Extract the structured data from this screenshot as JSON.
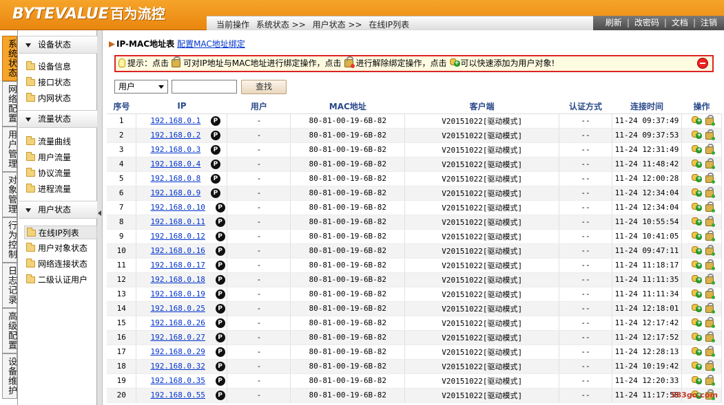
{
  "header": {
    "logo_text": "BYTEVALUE",
    "logo_cn": "百为流控",
    "breadcrumb": [
      "当前操作",
      "系统状态 >>",
      "用户状态 >>",
      "在线IP列表"
    ],
    "links": [
      "刷新",
      "改密码",
      "文档",
      "注销"
    ]
  },
  "vtabs": [
    "系统状态",
    "网络配置",
    "用户管理",
    "对象管理",
    "行为控制",
    "日志记录",
    "高级配置",
    "设备维护"
  ],
  "sidebar": {
    "sections": [
      {
        "title": "设备状态",
        "items": [
          "设备信息",
          "接口状态",
          "内网状态"
        ]
      },
      {
        "title": "流量状态",
        "items": [
          "流量曲线",
          "用户流量",
          "协议流量",
          "进程流量"
        ]
      },
      {
        "title": "用户状态",
        "items": [
          "在线IP列表",
          "用户对象状态",
          "网络连接状态",
          "二级认证用户"
        ]
      }
    ],
    "active_item": "在线IP列表"
  },
  "main": {
    "title": "IP-MAC地址表",
    "sub_link": "配置MAC地址绑定",
    "tip": {
      "prefix": "提示：点击",
      "part1": "可对IP地址与MAC地址进行绑定操作，点击",
      "part2": "进行解除绑定操作，点击",
      "part3": "可以快速添加为用户对象!"
    },
    "filter": {
      "select_value": "用户",
      "input_value": "",
      "search_label": "查找"
    },
    "columns": [
      "序号",
      "IP",
      "用户",
      "MAC地址",
      "客户端",
      "认证方式",
      "连接时间",
      "操作"
    ],
    "p_badge": "P",
    "rows": [
      {
        "no": "1",
        "ip": "192.168.0.1",
        "user": "-",
        "mac": "80-81-00-19-6B-82",
        "client": "V20151022[驱动模式]",
        "auth": "--",
        "time": "11-24 09:37:49"
      },
      {
        "no": "2",
        "ip": "192.168.0.2",
        "user": "-",
        "mac": "80-81-00-19-6B-82",
        "client": "V20151022[驱动模式]",
        "auth": "--",
        "time": "11-24 09:37:53"
      },
      {
        "no": "3",
        "ip": "192.168.0.3",
        "user": "-",
        "mac": "80-81-00-19-6B-82",
        "client": "V20151022[驱动模式]",
        "auth": "--",
        "time": "11-24 12:31:49"
      },
      {
        "no": "4",
        "ip": "192.168.0.4",
        "user": "-",
        "mac": "80-81-00-19-6B-82",
        "client": "V20151022[驱动模式]",
        "auth": "--",
        "time": "11-24 11:48:42"
      },
      {
        "no": "5",
        "ip": "192.168.0.8",
        "user": "-",
        "mac": "80-81-00-19-6B-82",
        "client": "V20151022[驱动模式]",
        "auth": "--",
        "time": "11-24 12:00:28"
      },
      {
        "no": "6",
        "ip": "192.168.0.9",
        "user": "-",
        "mac": "80-81-00-19-6B-82",
        "client": "V20151022[驱动模式]",
        "auth": "--",
        "time": "11-24 12:34:04"
      },
      {
        "no": "7",
        "ip": "192.168.0.10",
        "user": "-",
        "mac": "80-81-00-19-6B-82",
        "client": "V20151022[驱动模式]",
        "auth": "--",
        "time": "11-24 12:34:04"
      },
      {
        "no": "8",
        "ip": "192.168.0.11",
        "user": "-",
        "mac": "80-81-00-19-6B-82",
        "client": "V20151022[驱动模式]",
        "auth": "--",
        "time": "11-24 10:55:54"
      },
      {
        "no": "9",
        "ip": "192.168.0.12",
        "user": "-",
        "mac": "80-81-00-19-6B-82",
        "client": "V20151022[驱动模式]",
        "auth": "--",
        "time": "11-24 10:41:05"
      },
      {
        "no": "10",
        "ip": "192.168.0.16",
        "user": "-",
        "mac": "80-81-00-19-6B-82",
        "client": "V20151022[驱动模式]",
        "auth": "--",
        "time": "11-24 09:47:11"
      },
      {
        "no": "11",
        "ip": "192.168.0.17",
        "user": "-",
        "mac": "80-81-00-19-6B-82",
        "client": "V20151022[驱动模式]",
        "auth": "--",
        "time": "11-24 11:18:17"
      },
      {
        "no": "12",
        "ip": "192.168.0.18",
        "user": "-",
        "mac": "80-81-00-19-6B-82",
        "client": "V20151022[驱动模式]",
        "auth": "--",
        "time": "11-24 11:11:35"
      },
      {
        "no": "13",
        "ip": "192.168.0.19",
        "user": "-",
        "mac": "80-81-00-19-6B-82",
        "client": "V20151022[驱动模式]",
        "auth": "--",
        "time": "11-24 11:11:34"
      },
      {
        "no": "14",
        "ip": "192.168.0.25",
        "user": "-",
        "mac": "80-81-00-19-6B-82",
        "client": "V20151022[驱动模式]",
        "auth": "--",
        "time": "11-24 12:18:01"
      },
      {
        "no": "15",
        "ip": "192.168.0.26",
        "user": "-",
        "mac": "80-81-00-19-6B-82",
        "client": "V20151022[驱动模式]",
        "auth": "--",
        "time": "11-24 12:17:42"
      },
      {
        "no": "16",
        "ip": "192.168.0.27",
        "user": "-",
        "mac": "80-81-00-19-6B-82",
        "client": "V20151022[驱动模式]",
        "auth": "--",
        "time": "11-24 12:17:52"
      },
      {
        "no": "17",
        "ip": "192.168.0.29",
        "user": "-",
        "mac": "80-81-00-19-6B-82",
        "client": "V20151022[驱动模式]",
        "auth": "--",
        "time": "11-24 12:28:13"
      },
      {
        "no": "18",
        "ip": "192.168.0.32",
        "user": "-",
        "mac": "80-81-00-19-6B-82",
        "client": "V20151022[驱动模式]",
        "auth": "--",
        "time": "11-24 10:19:42"
      },
      {
        "no": "19",
        "ip": "192.168.0.35",
        "user": "-",
        "mac": "80-81-00-19-6B-82",
        "client": "V20151022[驱动模式]",
        "auth": "--",
        "time": "11-24 12:20:33"
      },
      {
        "no": "20",
        "ip": "192.168.0.55",
        "user": "-",
        "mac": "80-81-00-19-6B-82",
        "client": "V20151022[驱动模式]",
        "auth": "--",
        "time": "11-24 11:17:58"
      }
    ]
  },
  "watermark": "583go.com",
  "colors": {
    "header_orange": "#f6a42a",
    "link_blue": "#0033cc",
    "column_header": "#2b4a8a",
    "tip_border": "#dd2222"
  }
}
